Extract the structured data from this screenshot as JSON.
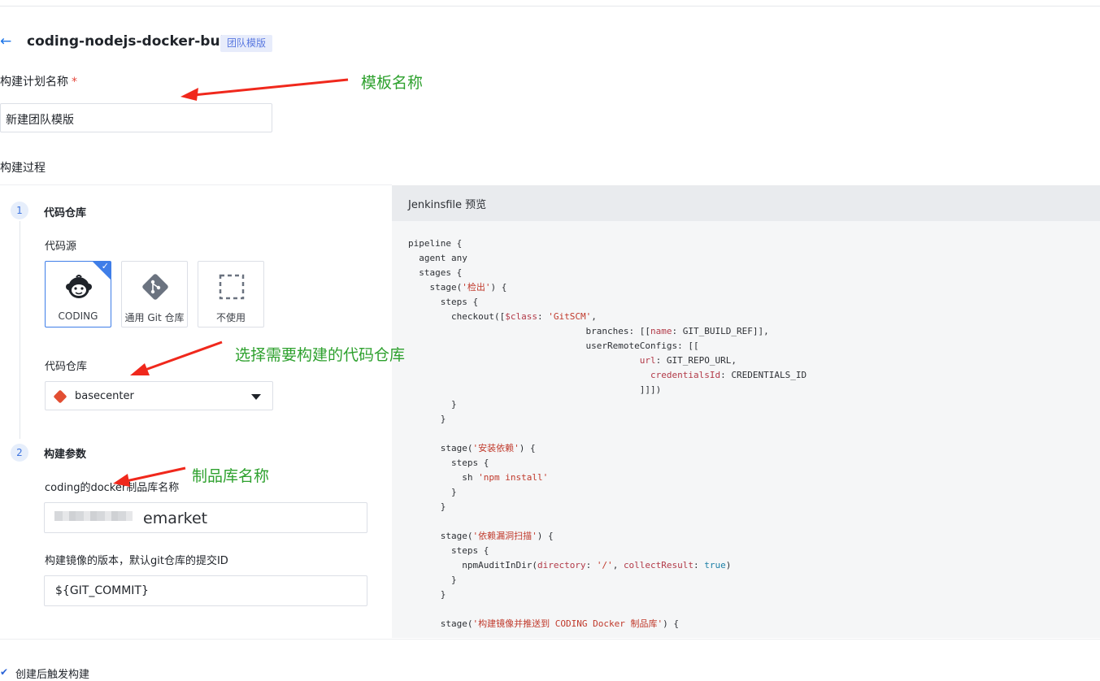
{
  "header": {
    "back_glyph": "←",
    "title": "coding-nodejs-docker-build",
    "tag": "团队模版"
  },
  "plan_name": {
    "label": "构建计划名称",
    "required_mark": "*",
    "value": "新建团队模版"
  },
  "process_label": "构建过程",
  "steps": [
    {
      "number": "1",
      "title": "代码仓库",
      "source_label": "代码源",
      "sources": [
        {
          "label": "CODING",
          "icon": "coding-monkey-icon",
          "selected": true
        },
        {
          "label": "通用 Git 仓库",
          "icon": "git-icon",
          "selected": false
        },
        {
          "label": "不使用",
          "icon": "dashed-square-icon",
          "selected": false
        }
      ],
      "repo_label": "代码仓库",
      "repo_value": "basecenter"
    },
    {
      "number": "2",
      "title": "构建参数",
      "param1_label": "coding的docker制品库名称",
      "param1_value": "emarket",
      "param2_label": "构建镜像的版本，默认git仓库的提交ID",
      "param2_value": "${GIT_COMMIT}"
    }
  ],
  "preview": {
    "title": "Jenkinsfile 预览"
  },
  "annotations": {
    "template_name": "模板名称",
    "select_repo": "选择需要构建的代码仓库",
    "artifact_name": "制品库名称"
  },
  "footer": {
    "trigger_label": "创建后触发构建",
    "trigger_checked": true
  },
  "colors": {
    "primary": "#3f7ee8",
    "annotation": "#2ea12e",
    "arrow": "#f0281c"
  }
}
